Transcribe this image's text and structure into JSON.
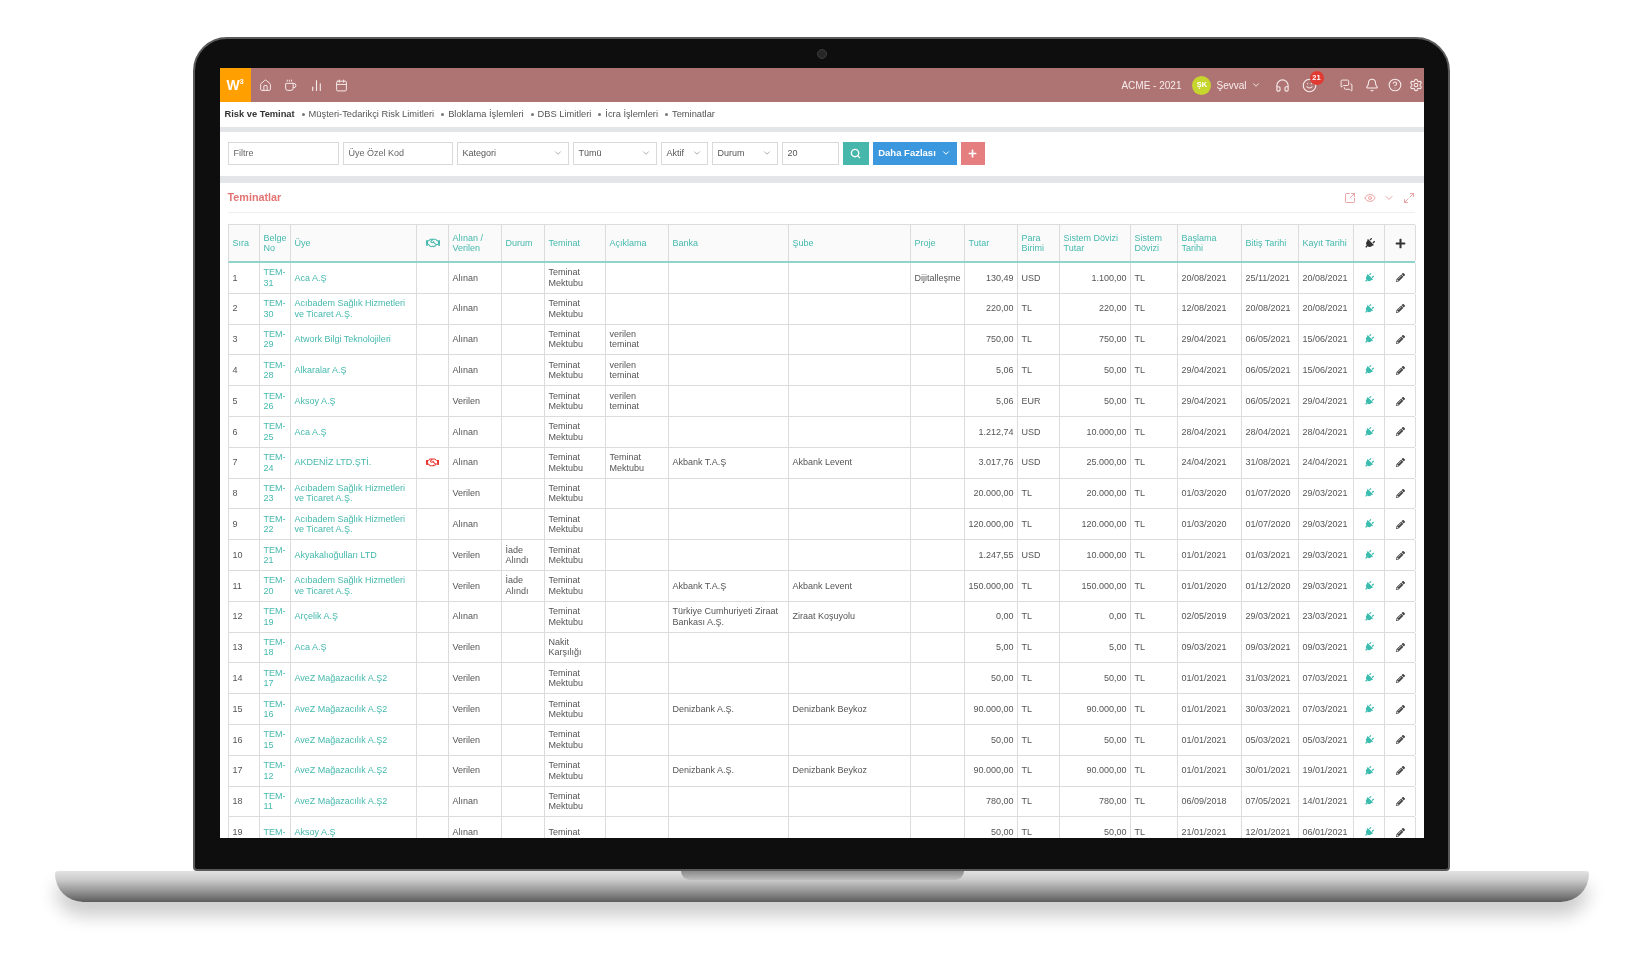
{
  "topbar": {
    "logo": "W$^{3}$",
    "company": "ACME - 2021",
    "avatar": "ŞK",
    "user": "Şevval",
    "badge": "21"
  },
  "breadcrumb": {
    "title": "Risk ve Teminat",
    "links": [
      "Müşteri-Tedarikçi Risk Limitleri",
      "Bloklama İşlemleri",
      "DBS Limitleri",
      "İcra İşlemleri",
      "Teminatlar"
    ]
  },
  "filters": [
    {
      "kind": "input",
      "placeholder": "Filtre"
    },
    {
      "kind": "input",
      "placeholder": "Üye Özel Kod"
    },
    {
      "kind": "select",
      "value": "Kategori"
    },
    {
      "kind": "select",
      "value": "Tümü"
    },
    {
      "kind": "select",
      "value": "Aktif"
    },
    {
      "kind": "select",
      "value": "Durum"
    },
    {
      "kind": "input",
      "value": "20"
    }
  ],
  "more_button": {
    "label": "Daha Fazlası"
  },
  "panel": {
    "title": "Teminatlar"
  },
  "table": {
    "columns": [
      {
        "kind": "text",
        "label": "Sıra"
      },
      {
        "kind": "text",
        "label": "Belge No"
      },
      {
        "kind": "text",
        "label": "Üye"
      },
      {
        "kind": "icon"
      },
      {
        "kind": "text",
        "label": "Alınan / Verilen"
      },
      {
        "kind": "text",
        "label": "Durum"
      },
      {
        "kind": "text",
        "label": "Teminat"
      },
      {
        "kind": "text",
        "label": "Açıklama"
      },
      {
        "kind": "text",
        "label": "Banka"
      },
      {
        "kind": "text",
        "label": "Şube"
      },
      {
        "kind": "text",
        "label": "Proje"
      },
      {
        "kind": "text",
        "label": "Tutar"
      },
      {
        "kind": "text",
        "label": "Para Birimi"
      },
      {
        "kind": "text",
        "label": "Sistem Dövizi Tutar"
      },
      {
        "kind": "text",
        "label": "Sistem Dövizi"
      },
      {
        "kind": "text",
        "label": "Başlama Tarihi"
      },
      {
        "kind": "text",
        "label": "Bitiş Tarihi"
      },
      {
        "kind": "text",
        "label": "Kayıt Tarihi"
      },
      {
        "kind": "icon"
      },
      {
        "kind": "icon"
      }
    ],
    "rows": [
      {
        "no": "1",
        "belge_no": "TEM-31",
        "uye": "Aca A.Ş",
        "handshake": false,
        "alinan_verilen": "Alınan",
        "teminat": "Teminat Mektubu",
        "proje": "Dijitalleşme",
        "tutar": "130,49",
        "para_birimi": "USD",
        "sistem_dovizi_tutar": "1.100,00",
        "sistem_dovizi": "TL",
        "baslama_tarihi": "20/08/2021",
        "bitis_tarihi": "25/11/2021",
        "kayit_tarihi": "20/08/2021"
      },
      {
        "no": "2",
        "belge_no": "TEM-30",
        "uye": "Acıbadem Sağlık Hizmetleri ve Ticaret A.Ş.",
        "handshake": false,
        "alinan_verilen": "Alınan",
        "teminat": "Teminat Mektubu",
        "tutar": "220,00",
        "para_birimi": "TL",
        "sistem_dovizi_tutar": "220,00",
        "sistem_dovizi": "TL",
        "baslama_tarihi": "12/08/2021",
        "bitis_tarihi": "20/08/2021",
        "kayit_tarihi": "20/08/2021"
      },
      {
        "no": "3",
        "belge_no": "TEM-29",
        "uye": "Atwork Bilgi Teknolojileri",
        "handshake": false,
        "alinan_verilen": "Alınan",
        "teminat": "Teminat Mektubu",
        "aciklama": "verilen teminat",
        "tutar": "750,00",
        "para_birimi": "TL",
        "sistem_dovizi_tutar": "750,00",
        "sistem_dovizi": "TL",
        "baslama_tarihi": "29/04/2021",
        "bitis_tarihi": "06/05/2021",
        "kayit_tarihi": "15/06/2021"
      },
      {
        "no": "4",
        "belge_no": "TEM-28",
        "uye": "Alkaralar A.Ş",
        "handshake": false,
        "alinan_verilen": "Alınan",
        "teminat": "Teminat Mektubu",
        "aciklama": "verilen teminat",
        "tutar": "5,06",
        "para_birimi": "TL",
        "sistem_dovizi_tutar": "50,00",
        "sistem_dovizi": "TL",
        "baslama_tarihi": "29/04/2021",
        "bitis_tarihi": "06/05/2021",
        "kayit_tarihi": "15/06/2021"
      },
      {
        "no": "5",
        "belge_no": "TEM-26",
        "uye": "Aksoy A.Ş",
        "handshake": false,
        "alinan_verilen": "Verilen",
        "teminat": "Teminat Mektubu",
        "aciklama": "verilen teminat",
        "tutar": "5,06",
        "para_birimi": "EUR",
        "sistem_dovizi_tutar": "50,00",
        "sistem_dovizi": "TL",
        "baslama_tarihi": "29/04/2021",
        "bitis_tarihi": "06/05/2021",
        "kayit_tarihi": "29/04/2021"
      },
      {
        "no": "6",
        "belge_no": "TEM-25",
        "uye": "Aca A.Ş",
        "handshake": false,
        "alinan_verilen": "Alınan",
        "teminat": "Teminat Mektubu",
        "tutar": "1.212,74",
        "para_birimi": "USD",
        "sistem_dovizi_tutar": "10.000,00",
        "sistem_dovizi": "TL",
        "baslama_tarihi": "28/04/2021",
        "bitis_tarihi": "28/04/2021",
        "kayit_tarihi": "28/04/2021"
      },
      {
        "no": "7",
        "belge_no": "TEM-24",
        "uye": "AKDENİZ LTD.ŞTİ.",
        "handshake": true,
        "alinan_verilen": "Alınan",
        "teminat": "Teminat Mektubu",
        "aciklama": "Teminat Mektubu",
        "banka": "Akbank T.A.Ş",
        "sube": "Akbank Levent",
        "tutar": "3.017,76",
        "para_birimi": "USD",
        "sistem_dovizi_tutar": "25.000,00",
        "sistem_dovizi": "TL",
        "baslama_tarihi": "24/04/2021",
        "bitis_tarihi": "31/08/2021",
        "kayit_tarihi": "24/04/2021"
      },
      {
        "no": "8",
        "belge_no": "TEM-23",
        "uye": "Acıbadem Sağlık Hizmetleri ve Ticaret A.Ş.",
        "handshake": false,
        "alinan_verilen": "Verilen",
        "teminat": "Teminat Mektubu",
        "tutar": "20.000,00",
        "para_birimi": "TL",
        "sistem_dovizi_tutar": "20.000,00",
        "sistem_dovizi": "TL",
        "baslama_tarihi": "01/03/2020",
        "bitis_tarihi": "01/07/2020",
        "kayit_tarihi": "29/03/2021"
      },
      {
        "no": "9",
        "belge_no": "TEM-22",
        "uye": "Acıbadem Sağlık Hizmetleri ve Ticaret A.Ş.",
        "handshake": false,
        "alinan_verilen": "Alınan",
        "teminat": "Teminat Mektubu",
        "tutar": "120.000,00",
        "para_birimi": "TL",
        "sistem_dovizi_tutar": "120.000,00",
        "sistem_dovizi": "TL",
        "baslama_tarihi": "01/03/2020",
        "bitis_tarihi": "01/07/2020",
        "kayit_tarihi": "29/03/2021"
      },
      {
        "no": "10",
        "belge_no": "TEM-21",
        "uye": "Akyakalıoğulları LTD",
        "handshake": false,
        "alinan_verilen": "Verilen",
        "durum": "İade Alındı",
        "teminat": "Teminat Mektubu",
        "tutar": "1.247,55",
        "para_birimi": "USD",
        "sistem_dovizi_tutar": "10.000,00",
        "sistem_dovizi": "TL",
        "baslama_tarihi": "01/01/2021",
        "bitis_tarihi": "01/03/2021",
        "kayit_tarihi": "29/03/2021"
      },
      {
        "no": "11",
        "belge_no": "TEM-20",
        "uye": "Acıbadem Sağlık Hizmetleri ve Ticaret A.Ş.",
        "handshake": false,
        "alinan_verilen": "Verilen",
        "durum": "İade Alındı",
        "teminat": "Teminat Mektubu",
        "banka": "Akbank T.A.Ş",
        "sube": "Akbank Levent",
        "tutar": "150.000,00",
        "para_birimi": "TL",
        "sistem_dovizi_tutar": "150.000,00",
        "sistem_dovizi": "TL",
        "baslama_tarihi": "01/01/2020",
        "bitis_tarihi": "01/12/2020",
        "kayit_tarihi": "29/03/2021"
      },
      {
        "no": "12",
        "belge_no": "TEM-19",
        "uye": "Arçelik A.Ş",
        "handshake": false,
        "alinan_verilen": "Alınan",
        "teminat": "Teminat Mektubu",
        "banka": "Türkiye Cumhuriyeti Ziraat Bankası A.Ş.",
        "sube": "Ziraat Koşuyolu",
        "tutar": "0,00",
        "para_birimi": "TL",
        "sistem_dovizi_tutar": "0,00",
        "sistem_dovizi": "TL",
        "baslama_tarihi": "02/05/2019",
        "bitis_tarihi": "29/03/2021",
        "kayit_tarihi": "23/03/2021"
      },
      {
        "no": "13",
        "belge_no": "TEM-18",
        "uye": "Aca A.Ş",
        "handshake": false,
        "alinan_verilen": "Verilen",
        "teminat": "Nakit Karşılığı",
        "tutar": "5,00",
        "para_birimi": "TL",
        "sistem_dovizi_tutar": "5,00",
        "sistem_dovizi": "TL",
        "baslama_tarihi": "09/03/2021",
        "bitis_tarihi": "09/03/2021",
        "kayit_tarihi": "09/03/2021"
      },
      {
        "no": "14",
        "belge_no": "TEM-17",
        "uye": "AveZ Mağazacılık A.Ş2",
        "handshake": false,
        "alinan_verilen": "Verilen",
        "teminat": "Teminat Mektubu",
        "tutar": "50,00",
        "para_birimi": "TL",
        "sistem_dovizi_tutar": "50,00",
        "sistem_dovizi": "TL",
        "baslama_tarihi": "01/01/2021",
        "bitis_tarihi": "31/03/2021",
        "kayit_tarihi": "07/03/2021"
      },
      {
        "no": "15",
        "belge_no": "TEM-16",
        "uye": "AveZ Mağazacılık A.Ş2",
        "handshake": false,
        "alinan_verilen": "Verilen",
        "teminat": "Teminat Mektubu",
        "banka": "Denizbank A.Ş.",
        "sube": "Denizbank Beykoz",
        "tutar": "90.000,00",
        "para_birimi": "TL",
        "sistem_dovizi_tutar": "90.000,00",
        "sistem_dovizi": "TL",
        "baslama_tarihi": "01/01/2021",
        "bitis_tarihi": "30/03/2021",
        "kayit_tarihi": "07/03/2021"
      },
      {
        "no": "16",
        "belge_no": "TEM-15",
        "uye": "AveZ Mağazacılık A.Ş2",
        "handshake": false,
        "alinan_verilen": "Verilen",
        "teminat": "Teminat Mektubu",
        "tutar": "50,00",
        "para_birimi": "TL",
        "sistem_dovizi_tutar": "50,00",
        "sistem_dovizi": "TL",
        "baslama_tarihi": "01/01/2021",
        "bitis_tarihi": "05/03/2021",
        "kayit_tarihi": "05/03/2021"
      },
      {
        "no": "17",
        "belge_no": "TEM-12",
        "uye": "AveZ Mağazacılık A.Ş2",
        "handshake": false,
        "alinan_verilen": "Verilen",
        "teminat": "Teminat Mektubu",
        "banka": "Denizbank A.Ş.",
        "sube": "Denizbank Beykoz",
        "tutar": "90.000,00",
        "para_birimi": "TL",
        "sistem_dovizi_tutar": "90.000,00",
        "sistem_dovizi": "TL",
        "baslama_tarihi": "01/01/2021",
        "bitis_tarihi": "30/01/2021",
        "kayit_tarihi": "19/01/2021"
      },
      {
        "no": "18",
        "belge_no": "TEM-11",
        "uye": "AveZ Mağazacılık A.Ş2",
        "handshake": false,
        "alinan_verilen": "Alınan",
        "teminat": "Teminat Mektubu",
        "tutar": "780,00",
        "para_birimi": "TL",
        "sistem_dovizi_tutar": "780,00",
        "sistem_dovizi": "TL",
        "baslama_tarihi": "06/09/2018",
        "bitis_tarihi": "07/05/2021",
        "kayit_tarihi": "14/01/2021"
      },
      {
        "no": "19",
        "belge_no": "TEM-",
        "uye": "Aksoy A.Ş",
        "handshake": false,
        "alinan_verilen": "Alınan",
        "teminat": "Teminat",
        "tutar": "50,00",
        "para_birimi": "TL",
        "sistem_dovizi_tutar": "50,00",
        "sistem_dovizi": "TL",
        "baslama_tarihi": "21/01/2021",
        "bitis_tarihi": "12/01/2021",
        "kayit_tarihi": "06/01/2021"
      }
    ]
  }
}
